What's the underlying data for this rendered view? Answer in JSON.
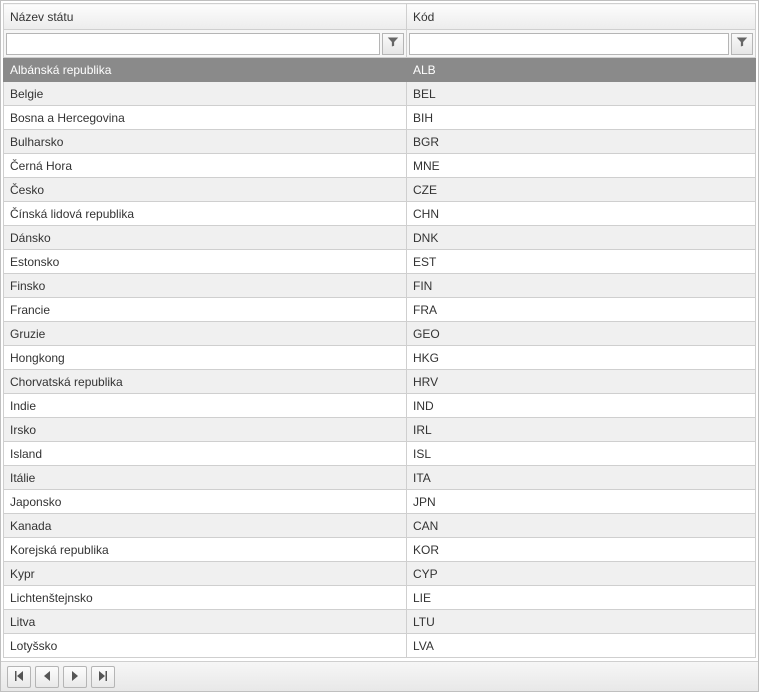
{
  "columns": {
    "name": "Název státu",
    "code": "Kód"
  },
  "filters": {
    "name": {
      "value": "",
      "placeholder": ""
    },
    "code": {
      "value": "",
      "placeholder": ""
    }
  },
  "selected_index": 0,
  "rows": [
    {
      "name": "Albánská republika",
      "code": "ALB"
    },
    {
      "name": "Belgie",
      "code": "BEL"
    },
    {
      "name": "Bosna a Hercegovina",
      "code": "BIH"
    },
    {
      "name": "Bulharsko",
      "code": "BGR"
    },
    {
      "name": "Černá Hora",
      "code": "MNE"
    },
    {
      "name": "Česko",
      "code": "CZE"
    },
    {
      "name": "Čínská lidová republika",
      "code": "CHN"
    },
    {
      "name": "Dánsko",
      "code": "DNK"
    },
    {
      "name": "Estonsko",
      "code": "EST"
    },
    {
      "name": "Finsko",
      "code": "FIN"
    },
    {
      "name": "Francie",
      "code": "FRA"
    },
    {
      "name": "Gruzie",
      "code": "GEO"
    },
    {
      "name": "Hongkong",
      "code": "HKG"
    },
    {
      "name": "Chorvatská republika",
      "code": "HRV"
    },
    {
      "name": "Indie",
      "code": "IND"
    },
    {
      "name": "Irsko",
      "code": "IRL"
    },
    {
      "name": "Island",
      "code": "ISL"
    },
    {
      "name": "Itálie",
      "code": "ITA"
    },
    {
      "name": "Japonsko",
      "code": "JPN"
    },
    {
      "name": "Kanada",
      "code": "CAN"
    },
    {
      "name": "Korejská republika",
      "code": "KOR"
    },
    {
      "name": "Kypr",
      "code": "CYP"
    },
    {
      "name": "Lichtenštejnsko",
      "code": "LIE"
    },
    {
      "name": "Litva",
      "code": "LTU"
    },
    {
      "name": "Lotyšsko",
      "code": "LVA"
    }
  ]
}
